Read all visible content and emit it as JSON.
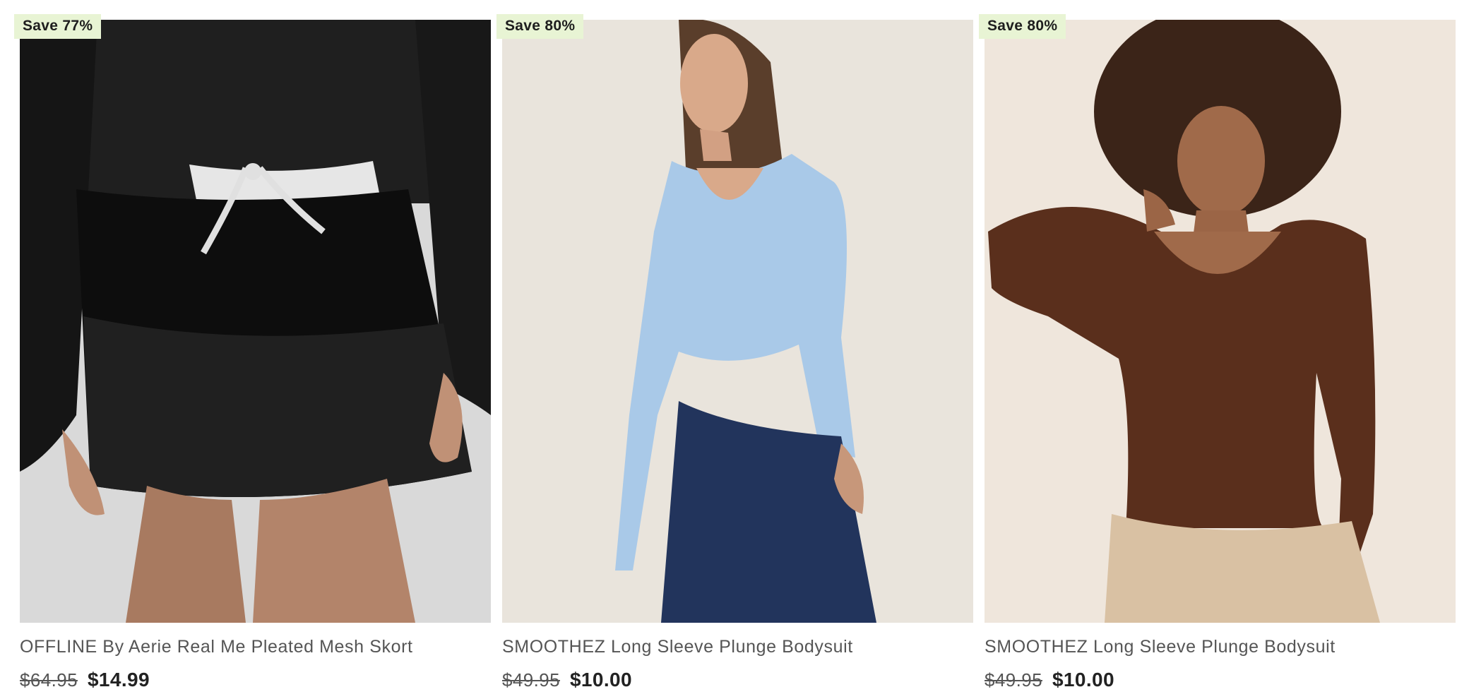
{
  "products": [
    {
      "badge": "Save 77%",
      "name": "OFFLINE By Aerie Real Me Pleated Mesh Skort",
      "original_price": "$64.95",
      "sale_price": "$14.99",
      "photo": "black-pleated-mesh-skort-model"
    },
    {
      "badge": "Save 80%",
      "name": "SMOOTHEZ Long Sleeve Plunge Bodysuit",
      "original_price": "$49.95",
      "sale_price": "$10.00",
      "photo": "light-blue-bodysuit-model"
    },
    {
      "badge": "Save 80%",
      "name": "SMOOTHEZ Long Sleeve Plunge Bodysuit",
      "original_price": "$49.95",
      "sale_price": "$10.00",
      "photo": "brown-bodysuit-model"
    }
  ],
  "colors": {
    "badge_bg": "#e8f4d4",
    "text_muted": "#555555",
    "text_strong": "#222222"
  }
}
